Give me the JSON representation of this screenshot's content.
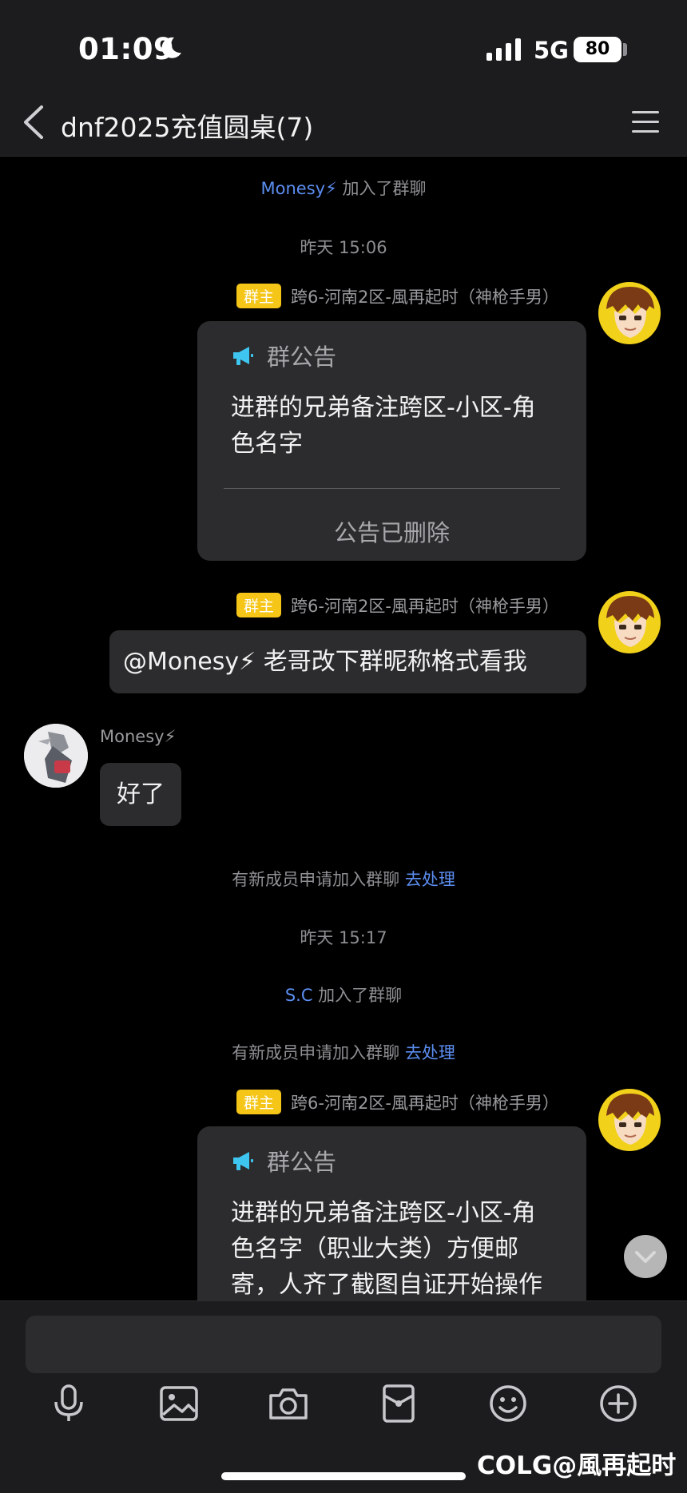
{
  "status_bar": {
    "time": "01:09",
    "network": "5G",
    "battery": "80"
  },
  "nav": {
    "title": "dnf2025充值圆桌(7)"
  },
  "messages": {
    "join1": {
      "name": "Monesy⚡",
      "text": "加入了群聊"
    },
    "time1": "昨天 15:06",
    "msg1": {
      "badge": "群主",
      "sender": "跨6-河南2区-風再起时（神枪手男）",
      "notice_title": "群公告",
      "notice_text": "进群的兄弟备注跨区-小区-角色名字",
      "notice_footer": "公告已删除"
    },
    "msg2": {
      "badge": "群主",
      "sender": "跨6-河南2区-風再起时（神枪手男）",
      "text": "@Monesy⚡ 老哥改下群昵称格式看我"
    },
    "msg3": {
      "sender": "Monesy⚡",
      "text": "好了"
    },
    "sys1": {
      "text": "有新成员申请加入群聊",
      "action": "去处理"
    },
    "time2": "昨天 15:17",
    "join2": {
      "name": "S.C",
      "text": "加入了群聊"
    },
    "sys2": {
      "text": "有新成员申请加入群聊",
      "action": "去处理"
    },
    "msg4": {
      "badge": "群主",
      "sender": "跨6-河南2区-風再起时（神枪手男）",
      "notice_title": "群公告",
      "notice_text": "进群的兄弟备注跨区-小区-角色名字（职业大类）方便邮寄，人齐了截图自证开始操作"
    }
  },
  "toolbar": {
    "icons": [
      "mic-icon",
      "image-icon",
      "camera-icon",
      "red-packet-icon",
      "emoji-icon",
      "plus-icon"
    ]
  },
  "watermark": "COLG@風再起时",
  "colors": {
    "accent_link": "#5b8def",
    "owner_badge": "#f5c518",
    "bubble": "#2c2c2e"
  }
}
